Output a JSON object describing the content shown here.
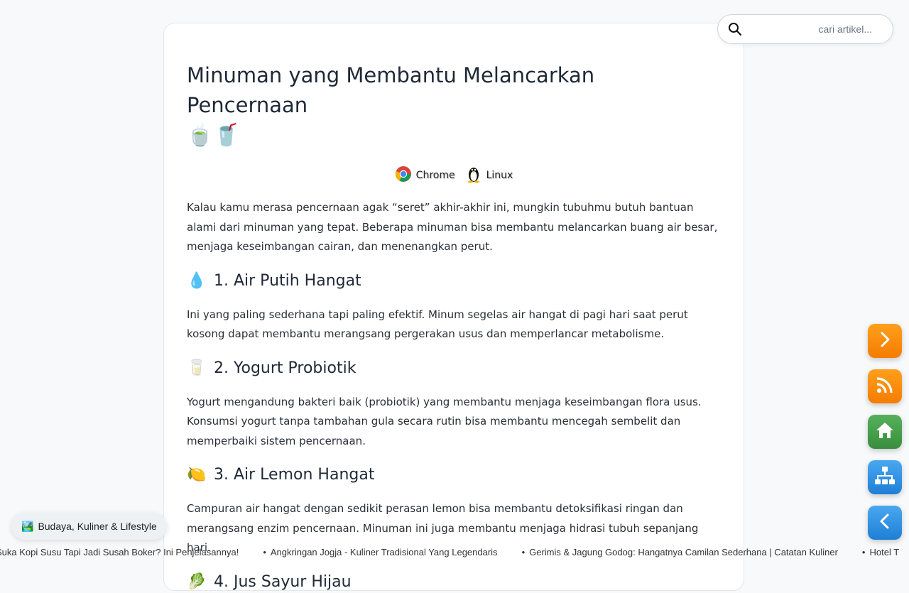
{
  "article": {
    "title": "Minuman yang Membantu Melancarkan Pencernaan",
    "title_emojis": "🍵🥤",
    "platforms": [
      {
        "icon": "chrome-icon",
        "label": "Chrome"
      },
      {
        "icon": "linux-tux-icon",
        "label": "Linux"
      }
    ],
    "intro": "Kalau kamu merasa pencernaan agak “seret” akhir-akhir ini, mungkin tubuhmu butuh bantuan alami dari minuman yang tepat. Beberapa minuman bisa membantu melancarkan buang air besar, menjaga keseimbangan cairan, dan menenangkan perut.",
    "sections": [
      {
        "emoji": "💧",
        "heading": "1. Air Putih Hangat",
        "text": "Ini yang paling sederhana tapi paling efektif. Minum segelas air hangat di pagi hari saat perut kosong dapat membantu merangsang pergerakan usus dan memperlancar metabolisme."
      },
      {
        "emoji": "🥛",
        "heading": "2. Yogurt Probiotik",
        "text": "Yogurt mengandung bakteri baik (probiotik) yang membantu menjaga keseimbangan flora usus. Konsumsi yogurt tanpa tambahan gula secara rutin bisa membantu mencegah sembelit dan memperbaiki sistem pencernaan."
      },
      {
        "emoji": "🍋",
        "heading": "3. Air Lemon Hangat",
        "text": "Campuran air hangat dengan sedikit perasan lemon bisa membantu detoksifikasi ringan dan merangsang enzim pencernaan. Minuman ini juga membantu menjaga hidrasi tubuh sepanjang hari."
      },
      {
        "emoji": "🥬",
        "heading": "4. Jus Sayur Hijau",
        "text": ""
      }
    ]
  },
  "search": {
    "placeholder": "cari artikel...",
    "value": ""
  },
  "side_buttons": [
    {
      "name": "next-button",
      "icon": "chevron-right-icon",
      "color": "#f57c00"
    },
    {
      "name": "rss-button",
      "icon": "rss-icon",
      "color": "#f57c00"
    },
    {
      "name": "home-button",
      "icon": "home-icon",
      "color": "#388e3c"
    },
    {
      "name": "sitemap-button",
      "icon": "sitemap-icon",
      "color": "#1e7fd6"
    },
    {
      "name": "back-button",
      "icon": "chevron-left-icon",
      "color": "#1e7fd6"
    }
  ],
  "category_chip": {
    "emoji": "🏞️",
    "label": "Budaya, Kuliner & Lifestyle"
  },
  "ticker": [
    "Suka Kopi Susu Tapi Jadi Susah Boker? Ini Penjelasannya!",
    "Angkringan Jogja - Kuliner Tradisional Yang Legendaris",
    "Gerimis & Jagung Godog: Hangatnya Camilan Sederhana | Catatan Kuliner",
    "Hotel T"
  ],
  "ticker_bullet": "•"
}
